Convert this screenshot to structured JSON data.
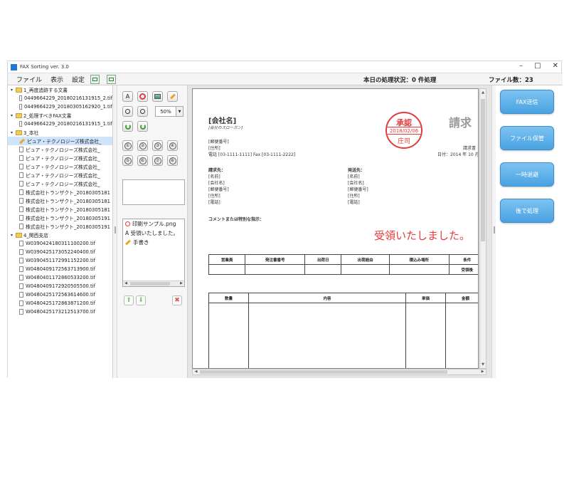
{
  "window": {
    "title": "FAX Sorting ver. 3.0",
    "controls": {
      "minimize": "–",
      "maximize": "□",
      "close": "✕"
    }
  },
  "menu": {
    "file": "ファイル",
    "view": "表示",
    "settings": "設定",
    "status": "本日の処理状況：0 件処理",
    "file_count": "ファイル数：23"
  },
  "tree": [
    {
      "type": "folder",
      "level": 0,
      "label": "1_再度追跡する文書"
    },
    {
      "type": "file",
      "level": 1,
      "label": "0449664229_20180216131915_2.tif"
    },
    {
      "type": "file",
      "level": 1,
      "label": "0449664229_20180305162920_1.tif"
    },
    {
      "type": "folder",
      "level": 0,
      "label": "2_処理すべきFAX文書"
    },
    {
      "type": "file",
      "level": 1,
      "label": "0449664229_20180216131915_1.tif"
    },
    {
      "type": "folder",
      "level": 0,
      "label": "3_本社"
    },
    {
      "type": "edit",
      "level": 1,
      "label": "ピュア・テクノロジーズ株式会社_",
      "selected": true
    },
    {
      "type": "file",
      "level": 1,
      "label": "ピュア・テクノロジーズ株式会社_"
    },
    {
      "type": "file",
      "level": 1,
      "label": "ピュア・テクノロジーズ株式会社_"
    },
    {
      "type": "file",
      "level": 1,
      "label": "ピュア・テクノロジーズ株式会社_"
    },
    {
      "type": "file",
      "level": 1,
      "label": "ピュア・テクノロジーズ株式会社_"
    },
    {
      "type": "file",
      "level": 1,
      "label": "ピュア・テクノロジーズ株式会社_"
    },
    {
      "type": "file",
      "level": 1,
      "label": "株式会社トランザクト_20180305181"
    },
    {
      "type": "file",
      "level": 1,
      "label": "株式会社トランザクト_20180305181"
    },
    {
      "type": "file",
      "level": 1,
      "label": "株式会社トランザクト_20180305181"
    },
    {
      "type": "file",
      "level": 1,
      "label": "株式会社トランザクト_20180305191"
    },
    {
      "type": "file",
      "level": 1,
      "label": "株式会社トランザクト_20180305191"
    },
    {
      "type": "folder",
      "level": 0,
      "label": "4_関西支店"
    },
    {
      "type": "file",
      "level": 1,
      "label": "W0390424180311100200.tif"
    },
    {
      "type": "file",
      "level": 1,
      "label": "W0390425173052240400.tif"
    },
    {
      "type": "file",
      "level": 1,
      "label": "W0390451172991152200.tif"
    },
    {
      "type": "file",
      "level": 1,
      "label": "W0480409172563713900.tif"
    },
    {
      "type": "file",
      "level": 1,
      "label": "W0480401172860533200.tif"
    },
    {
      "type": "file",
      "level": 1,
      "label": "W0480409172920505500.tif"
    },
    {
      "type": "file",
      "level": 1,
      "label": "W0480425172563614600.tif"
    },
    {
      "type": "file",
      "level": 1,
      "label": "W0480425172863871200.tif"
    },
    {
      "type": "file",
      "level": 1,
      "label": "W0480425173212513700.tif"
    }
  ],
  "tools": {
    "text_tool": "A",
    "zoom_value": "50%",
    "numbers": [
      "①",
      "②",
      "③",
      "④",
      "⑤",
      "⑥",
      "⑦",
      "⑧"
    ],
    "stamp_list": [
      {
        "icon": "image-stamp-icon",
        "label": "印刷サンプル.png"
      },
      {
        "icon": "text-stamp-icon",
        "label": "A 受領いたしました。"
      },
      {
        "icon": "pencil-icon",
        "label": "手書き"
      }
    ]
  },
  "document": {
    "company": "[会社名]",
    "slogan": "[会社のスローガン]",
    "title": "請求",
    "sender_lines": [
      "[郵便番号]",
      "[住所]",
      "電話 [03-1111-1111]   Fax [03-1111-2222]"
    ],
    "invoice_no": "請求書",
    "date": "日付：2014 年 10 月",
    "bill_to": {
      "label": "請求先：",
      "lines": [
        "[名前]",
        "[会社名]",
        "[郵便番号]",
        "[住所]",
        "[電話]"
      ]
    },
    "ship_to": {
      "label": "発送先：",
      "lines": [
        "[名前]",
        "[会社名]",
        "[郵便番号]",
        "[住所]",
        "[電話]"
      ]
    },
    "comment_label": "コメントまたは特別な指示：",
    "stamp": {
      "top": "承認",
      "date": "2018/02/06",
      "bottom": "庄司"
    },
    "handwritten": "受領いたしました。",
    "table1_headers": [
      "営業員",
      "発注書番号",
      "出荷日",
      "出荷経由",
      "積込み場所",
      "条件"
    ],
    "table1_row": [
      "",
      "",
      "",
      "",
      "",
      "受領後"
    ],
    "table2_headers": [
      "数量",
      "内容",
      "単価",
      "金額"
    ]
  },
  "actions": {
    "fax_send": "FAX送信",
    "file_store": "ファイル保管",
    "temp_store": "一時退避",
    "later": "後で処理"
  },
  "colors": {
    "accent_button": "#4aa2e1",
    "stamp_red": "#e23b3b",
    "selection": "#cfe3fb"
  }
}
